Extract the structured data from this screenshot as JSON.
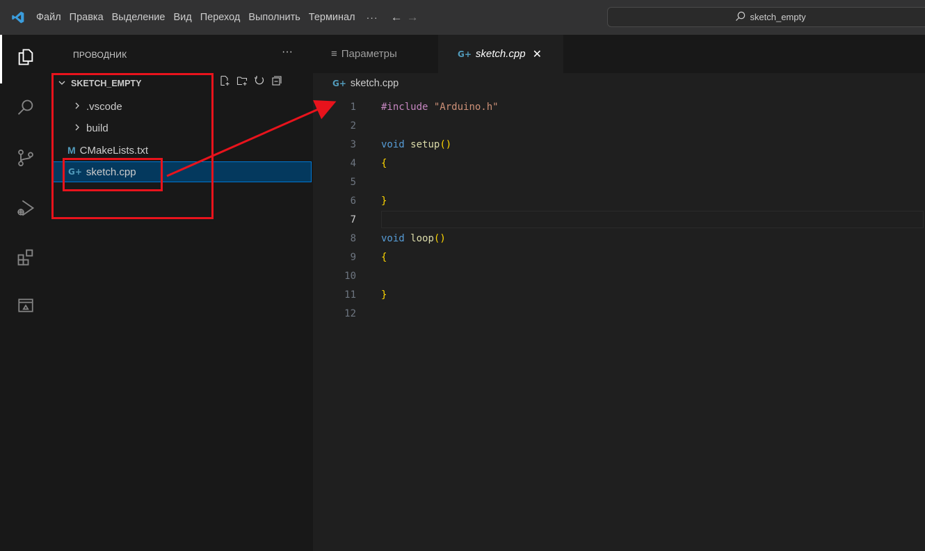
{
  "titlebar": {
    "menu": [
      "Файл",
      "Правка",
      "Выделение",
      "Вид",
      "Переход",
      "Выполнить",
      "Терминал"
    ],
    "more": "···",
    "back": "←",
    "forward": "→",
    "search_text": "sketch_empty"
  },
  "sidebar": {
    "header": "ПРОВОДНИК",
    "header_more": "···",
    "folder": "SKETCH_EMPTY",
    "items": [
      {
        "label": ".vscode",
        "type": "folder"
      },
      {
        "label": "build",
        "type": "folder"
      },
      {
        "label": "CMakeLists.txt",
        "type": "file",
        "icon": "M"
      },
      {
        "label": "sketch.cpp",
        "type": "file",
        "icon": "G+",
        "selected": true
      }
    ]
  },
  "editor": {
    "tabs": [
      {
        "label": "Параметры",
        "icon": "≡",
        "active": false
      },
      {
        "label": "sketch.cpp",
        "icon": "G+",
        "active": true,
        "close": "✕"
      }
    ],
    "breadcrumb": "sketch.cpp",
    "current_line": 7,
    "line_numbers": [
      "1",
      "2",
      "3",
      "4",
      "5",
      "6",
      "7",
      "8",
      "9",
      "10",
      "11",
      "12"
    ],
    "code": {
      "l1_directive": "#include",
      "l1_string": "\"Arduino.h\"",
      "l3_type": "void",
      "l3_fn": "setup",
      "l8_type": "void",
      "l8_fn": "loop",
      "open_paren": "(",
      "close_paren": ")",
      "open_brace": "{",
      "close_brace": "}"
    }
  },
  "colors": {
    "annotation": "#e8131c",
    "selection": "#04395e",
    "accent": "#0078d4"
  }
}
